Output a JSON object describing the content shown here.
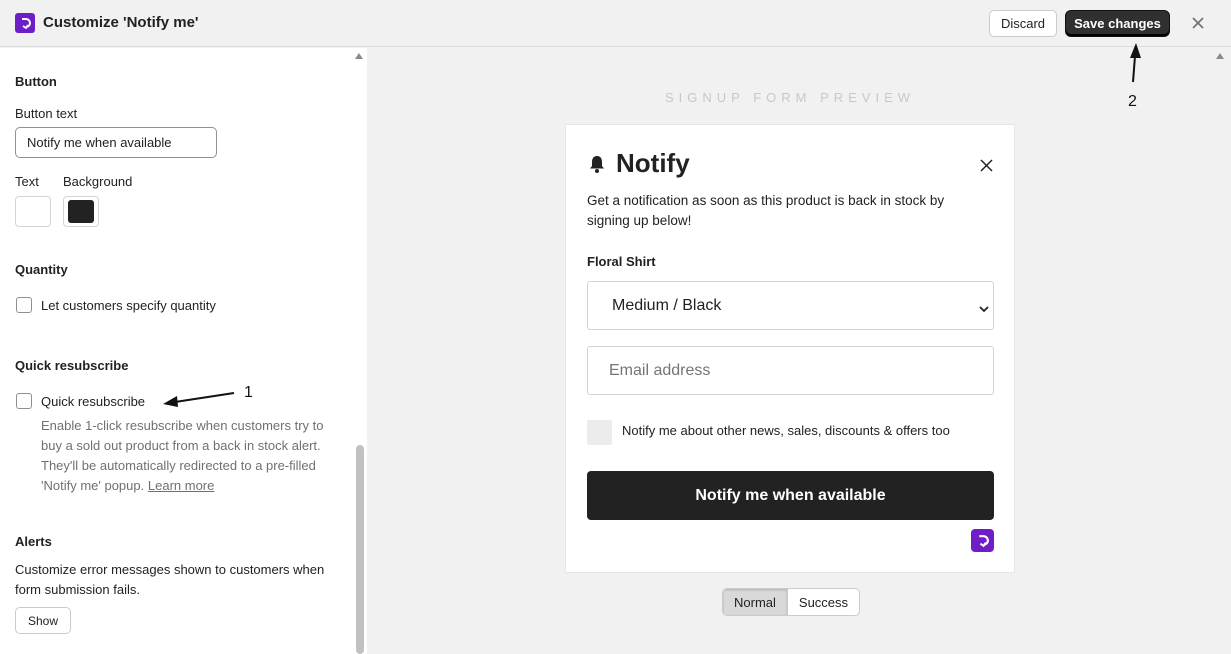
{
  "header": {
    "title": "Customize 'Notify me'",
    "discard_label": "Discard",
    "save_label": "Save changes"
  },
  "settings": {
    "button_section": {
      "title": "Button",
      "text_label": "Button text",
      "text_value": "Notify me when available",
      "color_text_label": "Text",
      "color_background_label": "Background",
      "text_color": "#ffffff",
      "background_color": "#222222"
    },
    "quantity_section": {
      "title": "Quantity",
      "checkbox_label": "Let customers specify quantity",
      "checked": false
    },
    "quick_resubscribe_section": {
      "title": "Quick resubscribe",
      "checkbox_label": "Quick resubscribe",
      "checked": false,
      "help_text": "Enable 1-click resubscribe when customers try to buy a sold out product from a back in stock alert. They'll be automatically redirected to a pre-filled 'Notify me' popup.",
      "learn_more_label": "Learn more"
    },
    "alerts_section": {
      "title": "Alerts",
      "description": "Customize error messages shown to customers when form submission fails.",
      "show_label": "Show"
    }
  },
  "preview": {
    "caption": "SIGNUP FORM PREVIEW",
    "form": {
      "title": "Notify",
      "description": "Get a notification as soon as this product is back in stock by signing up below!",
      "product_name": "Floral Shirt",
      "variant_value": "Medium / Black",
      "email_placeholder": "Email address",
      "marketing_label": "Notify me about other news, sales, discounts & offers too",
      "submit_label": "Notify me when available"
    },
    "tabs": [
      {
        "label": "Normal",
        "active": true
      },
      {
        "label": "Success",
        "active": false
      }
    ]
  },
  "annotations": {
    "marker_1": "1",
    "marker_2": "2"
  },
  "colors": {
    "brand": "#6f1dc6",
    "primary_button": "#303030"
  }
}
